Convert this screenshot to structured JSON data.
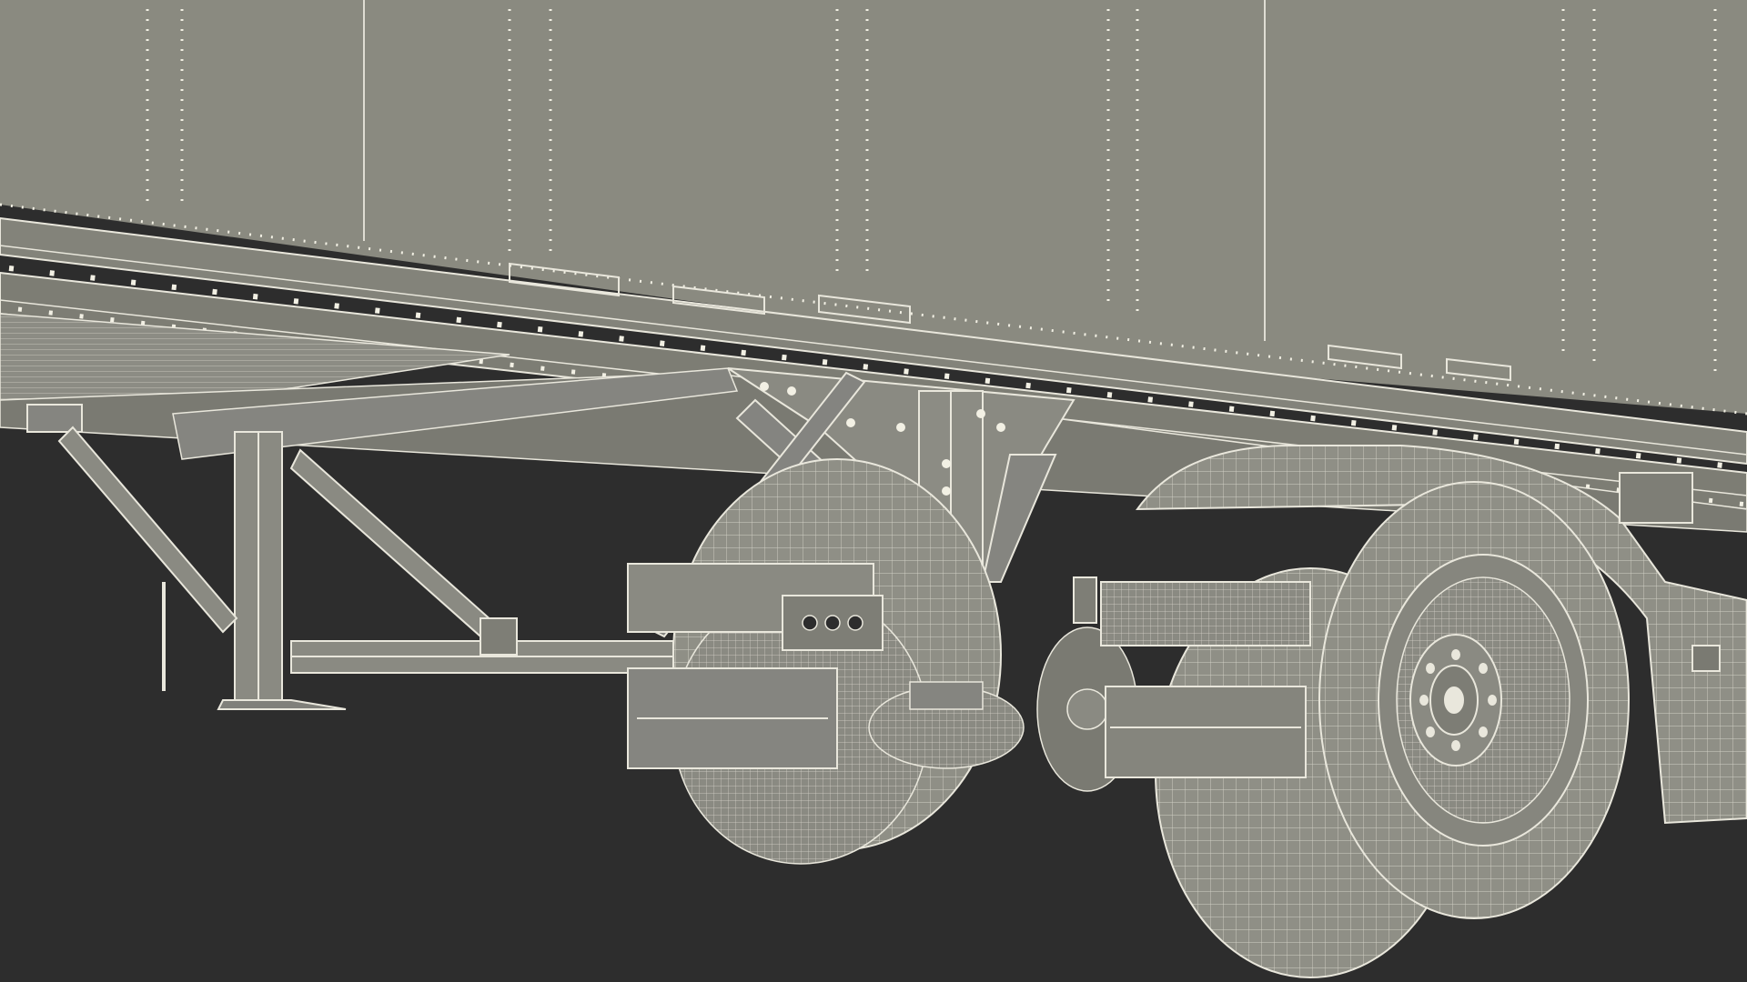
{
  "scene": {
    "subject": "semi-trailer-tractor-wireframe-render",
    "colors": {
      "background": "#2d2d2d",
      "panel": "#8a8a80",
      "panel_dark": "#6f6f66",
      "wire": "#e9e7dc",
      "rivet": "#f2f0e4",
      "shadow": "#3a3a38"
    }
  }
}
